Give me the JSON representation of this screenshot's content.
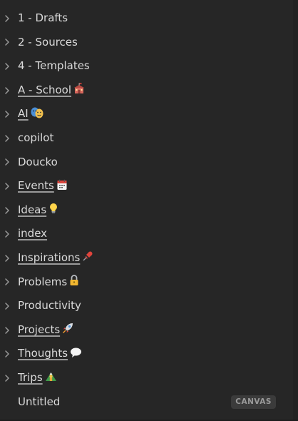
{
  "explorer": {
    "items": [
      {
        "label": "1 - Drafts",
        "type": "folder",
        "linked": false,
        "icon": null
      },
      {
        "label": "2 - Sources",
        "type": "folder",
        "linked": false,
        "icon": null
      },
      {
        "label": "4 - Templates",
        "type": "folder",
        "linked": false,
        "icon": null
      },
      {
        "label": "A - School",
        "type": "folder",
        "linked": true,
        "icon": "school-emoji-icon"
      },
      {
        "label": "AI",
        "type": "folder",
        "linked": true,
        "icon": "performing-arts-emoji-icon"
      },
      {
        "label": "copilot",
        "type": "folder",
        "linked": false,
        "icon": null
      },
      {
        "label": "Doucko",
        "type": "folder",
        "linked": false,
        "icon": null
      },
      {
        "label": "Events",
        "type": "folder",
        "linked": true,
        "icon": "calendar-emoji-icon"
      },
      {
        "label": "Ideas",
        "type": "folder",
        "linked": true,
        "icon": "light-bulb-emoji-icon"
      },
      {
        "label": "index",
        "type": "folder",
        "linked": true,
        "icon": null
      },
      {
        "label": "Inspirations",
        "type": "folder",
        "linked": true,
        "icon": "pushpin-emoji-icon"
      },
      {
        "label": "Problems",
        "type": "folder",
        "linked": false,
        "icon": "lock-emoji-icon"
      },
      {
        "label": "Productivity",
        "type": "folder",
        "linked": false,
        "icon": null
      },
      {
        "label": "Projects",
        "type": "folder",
        "linked": true,
        "icon": "rocket-emoji-icon"
      },
      {
        "label": "Thoughts",
        "type": "folder",
        "linked": true,
        "icon": "speech-bubble-emoji-icon"
      },
      {
        "label": "Trips",
        "type": "folder",
        "linked": true,
        "icon": "hiker-emoji-icon"
      },
      {
        "label": "Untitled",
        "type": "file",
        "linked": false,
        "icon": null,
        "badge": "CANVAS"
      }
    ]
  },
  "colors": {
    "background": "#262626",
    "text": "#dadada",
    "chevron": "#9a9a9a",
    "underline": "#9a9a9a",
    "badge_bg": "#3b3b3b",
    "badge_text": "#9a9a9a"
  }
}
